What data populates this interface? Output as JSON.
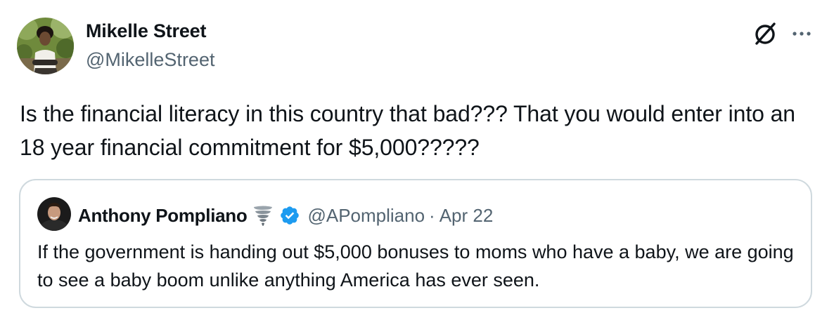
{
  "author": {
    "name": "Mikelle Street",
    "handle": "@MikelleStreet"
  },
  "icons": {
    "grok": "grok-slash-circle-icon",
    "more": "more-horizontal-icon",
    "verified": "verified-badge-icon",
    "tornado": "tornado-emoji-icon"
  },
  "tweet": {
    "text": "Is the financial literacy in this country that bad??? That you would enter into an 18 year financial commitment for $5,000?????"
  },
  "quote": {
    "name": "Anthony Pompliano",
    "handle": "@APompliano",
    "separator": "·",
    "date": "Apr 22",
    "text": "If the government is handing out $5,000 bonuses to moms who have a baby, we are going to see a baby boom unlike anything America has ever seen."
  },
  "colors": {
    "text": "#0f1419",
    "secondary": "#536471",
    "border": "#cfd9de",
    "verified": "#1d9bf0"
  }
}
